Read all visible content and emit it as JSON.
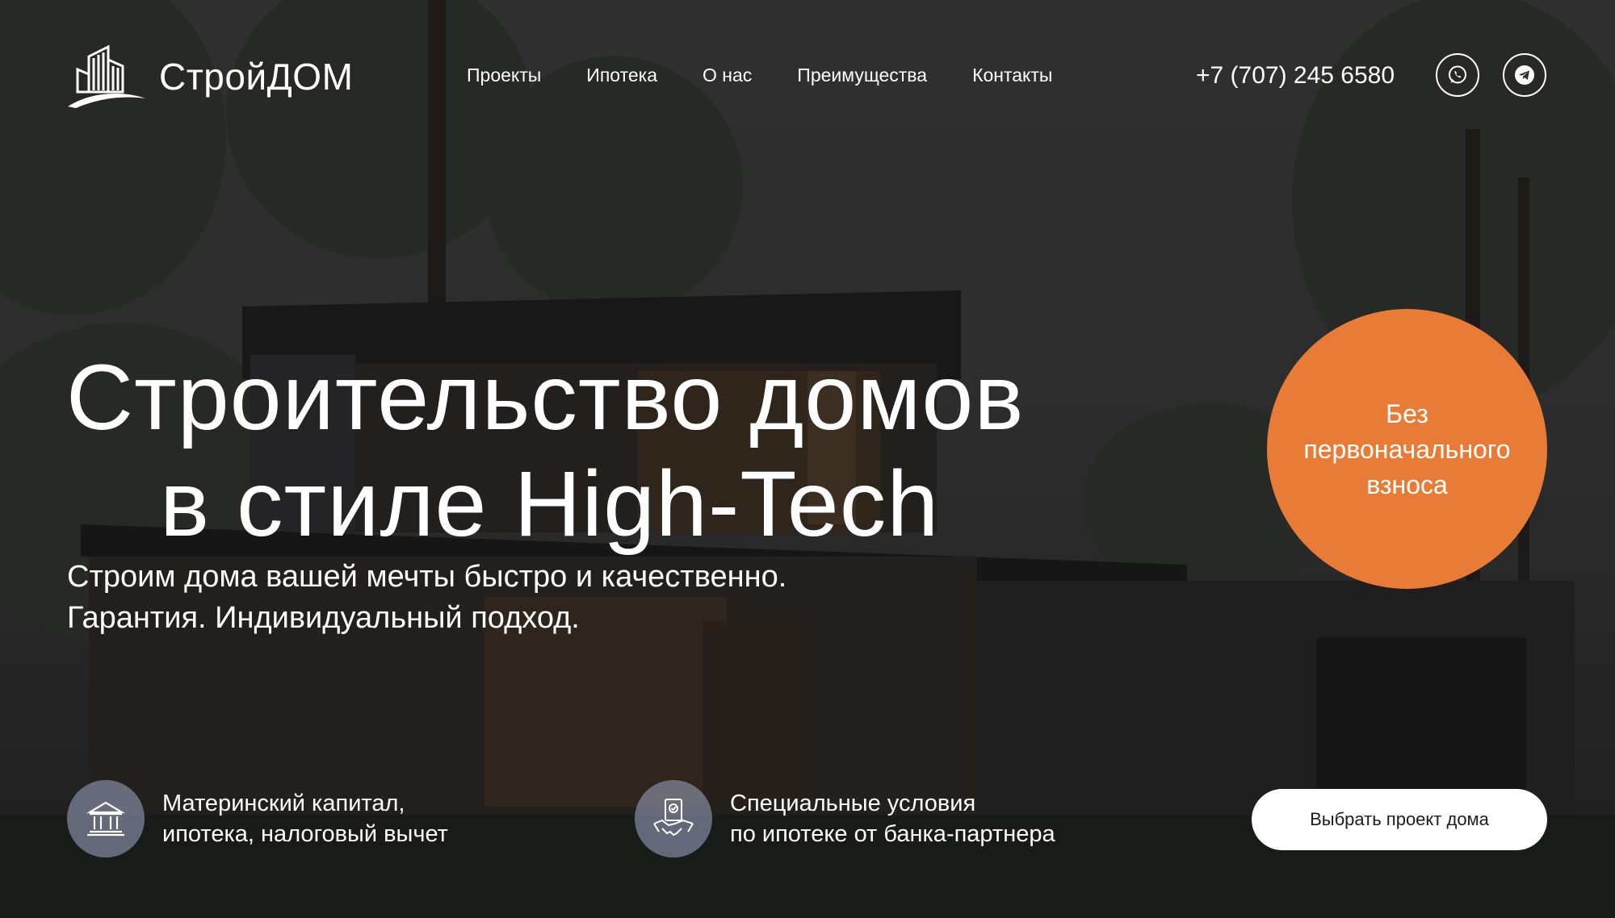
{
  "header": {
    "brand": "СтройДОМ",
    "logo_icon": "building-logo-icon",
    "nav": [
      "Проекты",
      "Ипотека",
      "О нас",
      "Преимущества",
      "Контакты"
    ],
    "phone": "+7 (707) 245 6580",
    "social": [
      {
        "name": "whatsapp",
        "icon": "whatsapp-icon"
      },
      {
        "name": "telegram",
        "icon": "telegram-icon"
      }
    ]
  },
  "hero": {
    "title_line1": "Строительство домов",
    "title_line2": "в стиле High-Tech",
    "subtitle_line1": "Строим дома вашей мечты быстро и качественно.",
    "subtitle_line2": "Гарантия. Индивидуальный подход."
  },
  "offer": {
    "line1": "Без",
    "line2": "первоначального",
    "line3": "взноса",
    "color": "#e87c37"
  },
  "features": [
    {
      "icon": "bank-icon",
      "line1": "Материнский капитал,",
      "line2": "ипотека, налоговый вычет"
    },
    {
      "icon": "handshake-document-icon",
      "line1": "Специальные условия",
      "line2": "по ипотеке от банка-партнера"
    }
  ],
  "cta": {
    "label": "Выбрать проект дома"
  },
  "colors": {
    "accent": "#e87c37",
    "overlay": "#2b2b2b",
    "icon_circle": "#8c93ad"
  }
}
